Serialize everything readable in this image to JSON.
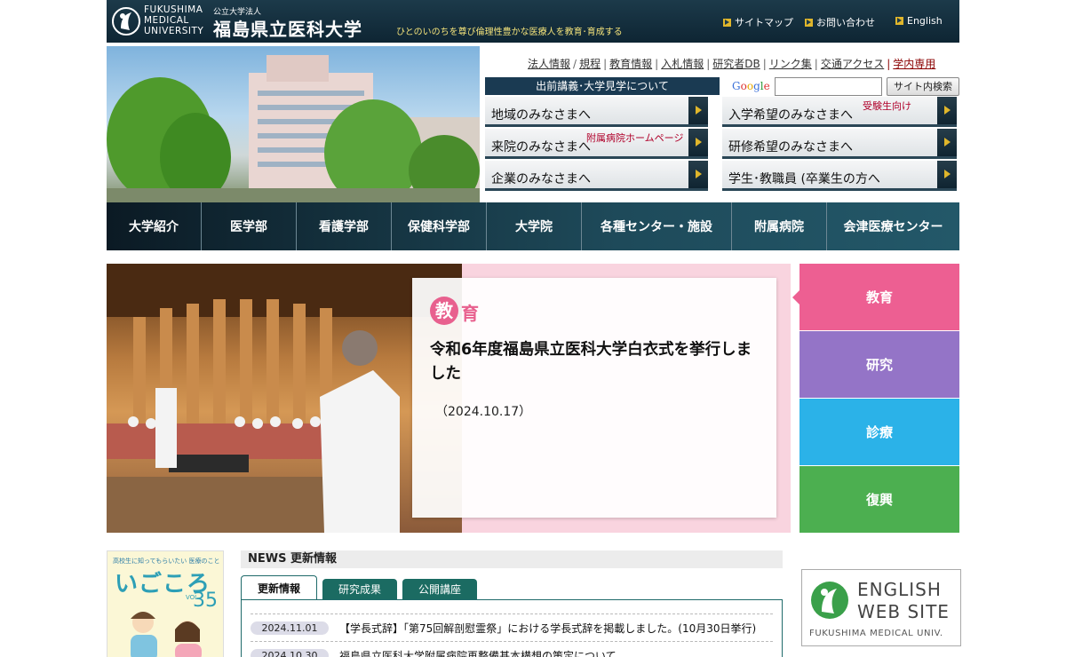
{
  "header": {
    "logo_en": [
      "FUKUSHIMA",
      "MEDICAL",
      "UNIVERSITY"
    ],
    "org_small": "公立大学法人",
    "org_name": "福島県立医科大学",
    "tagline": "ひとのいのちを尊び倫理性豊かな医療人を教育･育成する",
    "util_links": [
      "サイトマップ",
      "お問い合わせ",
      "English"
    ]
  },
  "top_links": [
    "法人情報",
    "規程",
    "教育情報",
    "入札情報",
    "研究者DB",
    "リンク集",
    "交通アクセス",
    "学内専用"
  ],
  "demae": "出前講義･大学見学について",
  "search": {
    "brand": "Google",
    "button": "サイト内検索",
    "value": ""
  },
  "audience": {
    "region": "地域のみなさまへ",
    "applicants": "入学希望のみなさまへ",
    "applicants_note": "受験生向け",
    "patients": "来院のみなさまへ",
    "patients_note": "附属病院ホームページ",
    "trainees": "研修希望のみなさまへ",
    "companies": "企業のみなさまへ",
    "students": "学生･教職員 (卒業生の方へ"
  },
  "gnav": [
    "大学紹介",
    "医学部",
    "看護学部",
    "保健科学部",
    "大学院",
    "各種センター・施設",
    "附属病院",
    "会津医療センター"
  ],
  "feature": {
    "category_first": "教",
    "category_rest": "育",
    "title": "令和6年度福島県立医科大学白衣式を挙行しました",
    "date": "（2024.10.17）"
  },
  "side_tabs": [
    {
      "label": "教育",
      "color": "#ed5f92"
    },
    {
      "label": "研究",
      "color": "#9474c7"
    },
    {
      "label": "診療",
      "color": "#2bb2e8"
    },
    {
      "label": "復興",
      "color": "#4caf50"
    }
  ],
  "magazine": {
    "subtitle": "高校生に知ってもらいたい 医療のこと",
    "title": "いごころ",
    "vol": "VOL.",
    "vol_num": "35"
  },
  "news": {
    "heading": "NEWS 更新情報",
    "tabs": [
      "更新情報",
      "研究成果",
      "公開講座"
    ],
    "items": [
      {
        "date": "2024.11.01",
        "text": "【学長式辞】「第75回解剖慰霊祭」における学長式辞を掲載しました。(10月30日挙行)"
      },
      {
        "date": "2024.10.30",
        "text": "福島県立医科大学附属病院再整備基本構想の策定について"
      }
    ]
  },
  "english_banner": {
    "line1": "ENGLISH",
    "line2": "WEB SITE",
    "line3": "FUKUSHIMA MEDICAL UNIV."
  }
}
